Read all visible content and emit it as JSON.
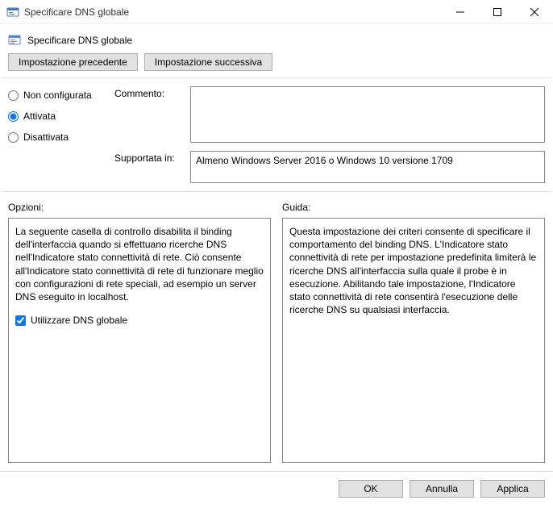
{
  "window": {
    "title": "Specificare DNS globale"
  },
  "header": {
    "title": "Specificare DNS globale"
  },
  "nav": {
    "prev": "Impostazione precedente",
    "next": "Impostazione successiva"
  },
  "state": {
    "not_configured": "Non configurata",
    "enabled": "Attivata",
    "disabled": "Disattivata"
  },
  "labels": {
    "comment": "Commento:",
    "supported": "Supportata in:",
    "options": "Opzioni:",
    "guide": "Guida:"
  },
  "supported_text": "Almeno Windows Server 2016 o Windows 10 versione 1709",
  "options": {
    "text": "La seguente casella di controllo disabilita il binding dell'interfaccia quando si effettuano ricerche DNS nell'Indicatore stato connettività di rete. Ciò consente all'Indicatore stato connettività di rete di funzionare meglio con configurazioni di rete speciali, ad esempio un server DNS eseguito in localhost.",
    "checkbox_label": "Utilizzare DNS globale"
  },
  "guide_text": "Questa impostazione dei criteri consente di specificare il comportamento del binding DNS. L'Indicatore stato connettività di rete per impostazione predefinita limiterà le ricerche DNS all'interfaccia sulla quale il probe è in esecuzione. Abilitando tale impostazione, l'Indicatore stato connettività di rete consentirà l'esecuzione delle ricerche DNS su qualsiasi interfaccia.",
  "buttons": {
    "ok": "OK",
    "cancel": "Annulla",
    "apply": "Applica"
  }
}
